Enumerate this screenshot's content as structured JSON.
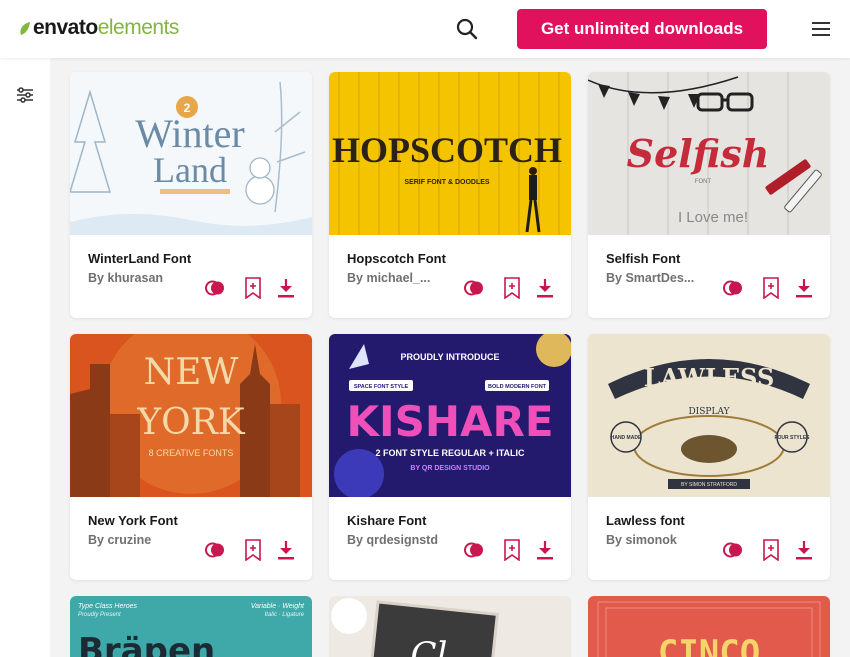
{
  "header": {
    "logo_part1": "envato",
    "logo_part2": "elements",
    "cta_label": "Get unlimited downloads",
    "icons": {
      "search": "search-icon",
      "menu": "hamburger-menu-icon"
    },
    "accent_color": "#e2115d"
  },
  "sidebar": {
    "filter_icon": "filter-sliders-icon"
  },
  "cards": [
    {
      "title": "WinterLand Font",
      "author": "By khurasan",
      "thumb": {
        "line1": "Winter",
        "line2": "Land",
        "badge": "2"
      }
    },
    {
      "title": "Hopscotch Font",
      "author": "By michael_...",
      "thumb": {
        "line1": "HOPSCOTCH",
        "line2": "SERIF FONT & DOODLES"
      }
    },
    {
      "title": "Selfish Font",
      "author": "By SmartDes...",
      "thumb": {
        "line1": "Selfish",
        "line2": "FONT",
        "line3": "I Love me!"
      }
    },
    {
      "title": "New York Font",
      "author": "By cruzine",
      "thumb": {
        "line1": "NEW",
        "line2": "YORK",
        "line3": "8 CREATIVE FONTS"
      }
    },
    {
      "title": "Kishare Font",
      "author": "By qrdesignstd",
      "thumb": {
        "line0": "PROUDLY INTRODUCE",
        "tag_left": "SPACE FONT STYLE",
        "tag_right": "BOLD MODERN FONT",
        "line1": "KISHARE",
        "line2": "2 FONT STYLE REGULAR + ITALIC",
        "line3": "BY QR DESIGN STUDIO"
      }
    },
    {
      "title": "Lawless font",
      "author": "By simonok",
      "thumb": {
        "line1": "LAWLESS",
        "line2": "DISPLAY",
        "left_badge": "HAND MADE",
        "right_badge": "FOUR STYLES",
        "footer": "BY SIMON STRATFORD"
      }
    }
  ],
  "partial_cards": [
    {
      "line1": "Type Class Heroes",
      "line2": "Proudly Present",
      "line3": "Variable · Weight",
      "line4": "Italic · Ligature",
      "big": "Bräpen"
    },
    {
      "big": "Cl"
    },
    {
      "big": "CINCO"
    }
  ],
  "action_icons": {
    "similar": "find-similar-icon",
    "bookmark": "add-to-collection-icon",
    "download": "download-icon"
  }
}
